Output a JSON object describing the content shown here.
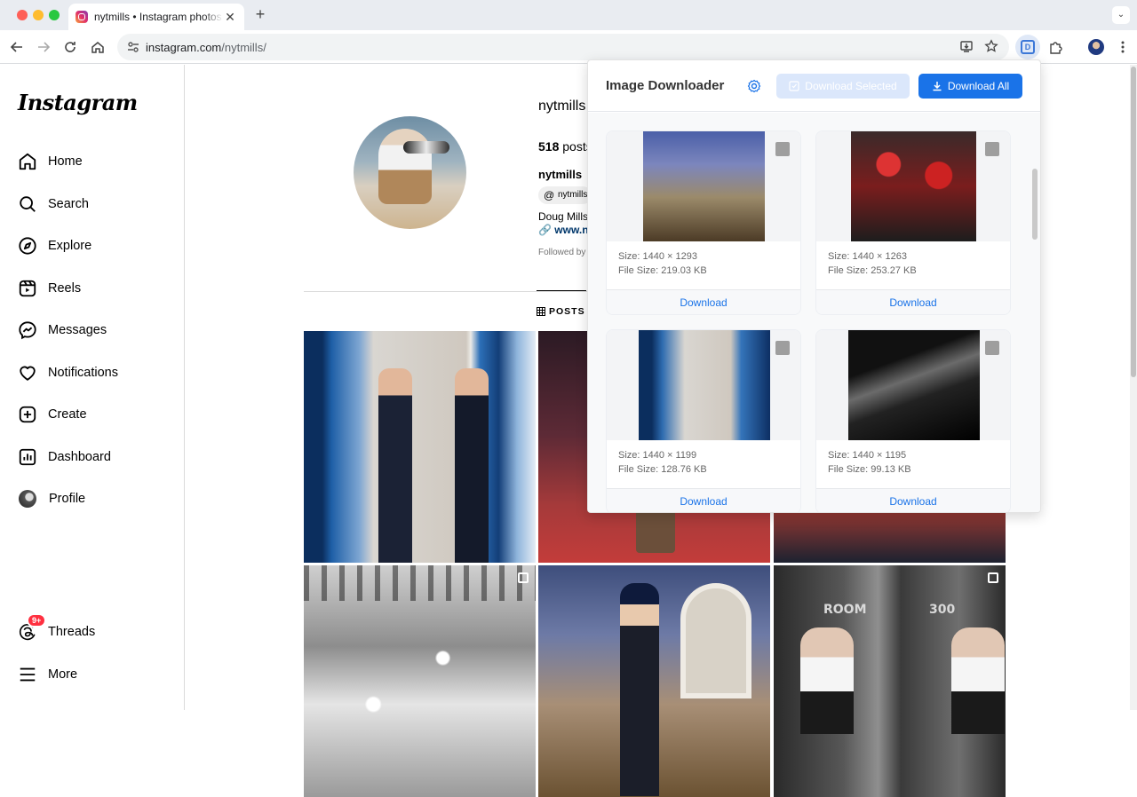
{
  "browser": {
    "tab_title": "nytmills • Instagram photos and videos",
    "url_host": "instagram.com",
    "url_path": "/nytmills/"
  },
  "instagram": {
    "logo": "Instagram",
    "nav": {
      "home": "Home",
      "search": "Search",
      "explore": "Explore",
      "reels": "Reels",
      "messages": "Messages",
      "notifications": "Notifications",
      "create": "Create",
      "dashboard": "Dashboard",
      "profile": "Profile",
      "threads": "Threads",
      "threads_badge": "9+",
      "more": "More"
    },
    "profile": {
      "username": "nytmills",
      "posts_number": "518",
      "posts_label": "posts",
      "display_name": "nytmills",
      "threads_handle": "nytmills",
      "bio_name": "Doug Mills",
      "bio_link": "www.n",
      "followed_by": "Followed by"
    },
    "tabs": {
      "posts": "POSTS"
    },
    "grid_room_left": "ROOM",
    "grid_room_right": "300"
  },
  "downloader": {
    "title": "Image Downloader",
    "download_selected": "Download Selected",
    "download_all": "Download All",
    "images": [
      {
        "size": "Size: 1440 × 1293",
        "file_size": "File Size: 219.03 KB",
        "download": "Download"
      },
      {
        "size": "Size: 1440 × 1263",
        "file_size": "File Size: 253.27 KB",
        "download": "Download"
      },
      {
        "size": "Size: 1440 × 1199",
        "file_size": "File Size: 128.76 KB",
        "download": "Download"
      },
      {
        "size": "Size: 1440 × 1195",
        "file_size": "File Size: 99.13 KB",
        "download": "Download"
      }
    ]
  },
  "colors": {
    "accent": "#1a73e8",
    "badge": "#ff3040",
    "link": "#00376b"
  }
}
